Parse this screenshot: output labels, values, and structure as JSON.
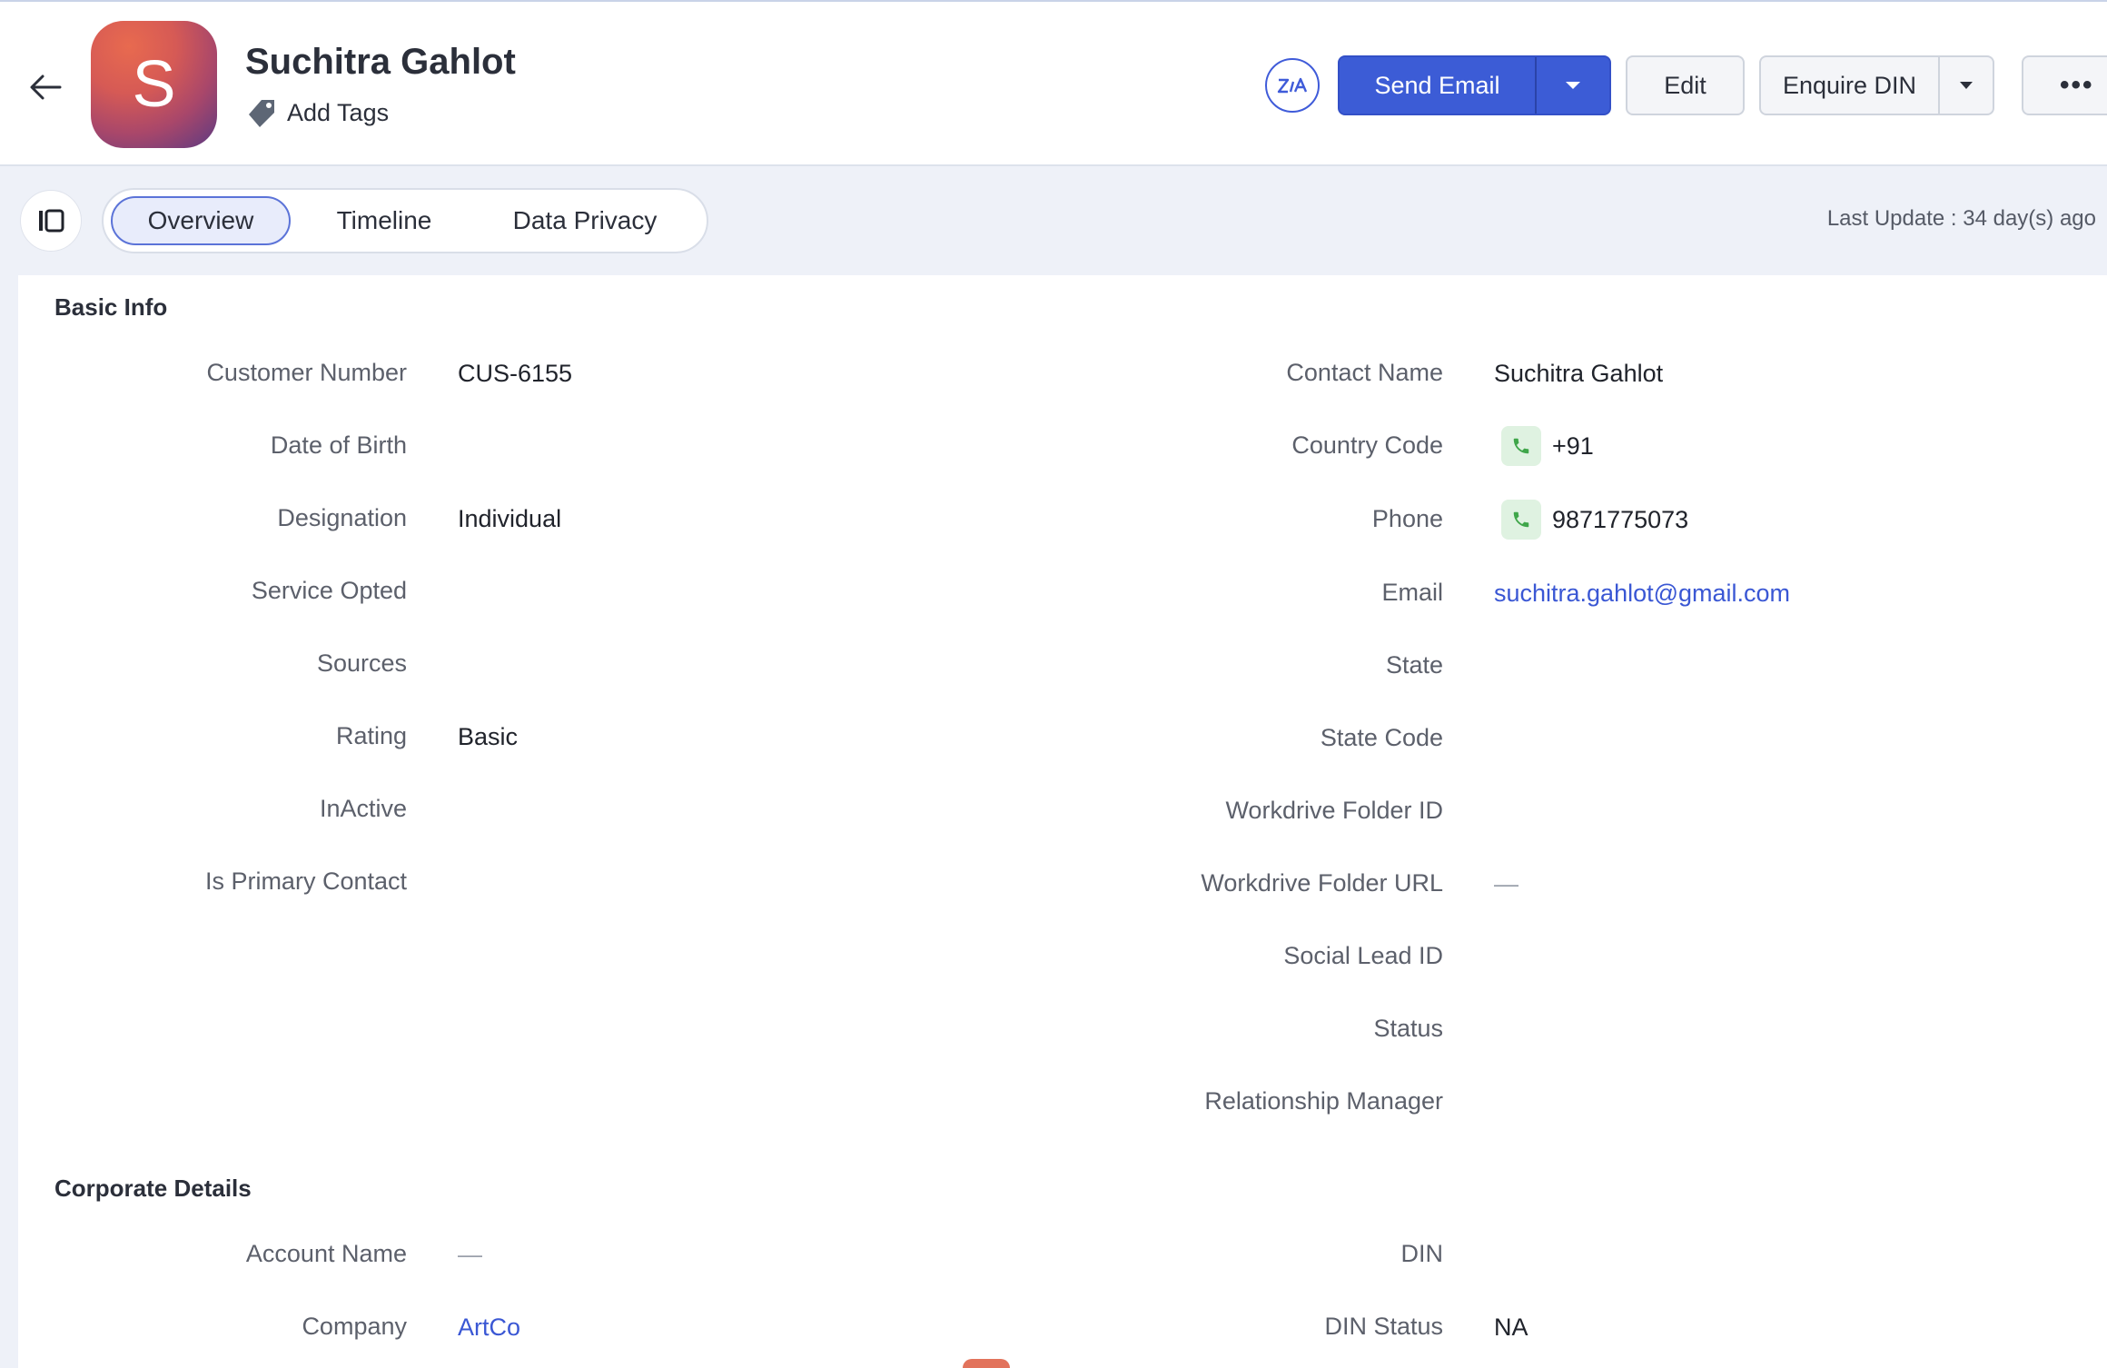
{
  "header": {
    "avatar_letter": "S",
    "name": "Suchitra Gahlot",
    "add_tags": "Add Tags",
    "zia": "Zia",
    "send_email": "Send Email",
    "edit": "Edit",
    "enquire_din": "Enquire DIN",
    "more": "•••"
  },
  "tabs": {
    "overview": "Overview",
    "timeline": "Timeline",
    "data_privacy": "Data Privacy",
    "last_update": "Last Update : 34 day(s) ago"
  },
  "basic_info": {
    "title": "Basic Info",
    "left": [
      {
        "label": "Customer Number",
        "value": "CUS-6155"
      },
      {
        "label": "Date of Birth",
        "value": ""
      },
      {
        "label": "Designation",
        "value": "Individual"
      },
      {
        "label": "Service Opted",
        "value": ""
      },
      {
        "label": "Sources",
        "value": ""
      },
      {
        "label": "Rating",
        "value": "Basic"
      },
      {
        "label": "InActive",
        "value": ""
      },
      {
        "label": "Is Primary Contact",
        "value": ""
      }
    ],
    "right": [
      {
        "label": "Contact Name",
        "value": "Suchitra Gahlot"
      },
      {
        "label": "Country Code",
        "value": "+91"
      },
      {
        "label": "Phone",
        "value": "9871775073"
      },
      {
        "label": "Email",
        "value": "suchitra.gahlot@gmail.com"
      },
      {
        "label": "State",
        "value": ""
      },
      {
        "label": "State Code",
        "value": ""
      },
      {
        "label": "Workdrive Folder ID",
        "value": ""
      },
      {
        "label": "Workdrive Folder URL",
        "value": "—"
      },
      {
        "label": "Social Lead ID",
        "value": ""
      },
      {
        "label": "Status",
        "value": ""
      },
      {
        "label": "Relationship Manager",
        "value": ""
      }
    ]
  },
  "corporate_details": {
    "title": "Corporate Details",
    "left": [
      {
        "label": "Account Name",
        "value": "—"
      },
      {
        "label": "Company",
        "value": "ArtCo"
      }
    ],
    "right": [
      {
        "label": "DIN",
        "value": ""
      },
      {
        "label": "DIN Status",
        "value": "NA"
      }
    ]
  },
  "colors": {
    "primary": "#3c5cd6",
    "link": "#3a57d4",
    "phone_icon_bg": "#dff2e1",
    "tabbar_bg": "#eef1f8"
  },
  "icons": [
    "back-arrow-icon",
    "tag-icon",
    "zia-icon",
    "chevron-down-icon",
    "more-icon",
    "sidebar-toggle-icon",
    "phone-icon"
  ]
}
